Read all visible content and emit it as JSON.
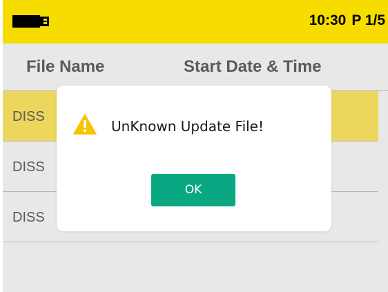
{
  "status_bar": {
    "usb_icon": "usb-drive-icon",
    "time": "10:30",
    "page": "P 1/5",
    "background": "#f7dc00"
  },
  "table": {
    "columns": [
      "File Name",
      "Start Date & Time"
    ],
    "rows": [
      {
        "name": "DISS",
        "selected": true
      },
      {
        "name": "DISS",
        "selected": false
      },
      {
        "name": "DISS",
        "selected": false
      },
      {
        "name": "",
        "selected": false
      }
    ]
  },
  "dialog": {
    "icon": "warning-icon",
    "message": "UnKnown Update File!",
    "ok_label": "OK",
    "ok_color": "#0aa882"
  }
}
